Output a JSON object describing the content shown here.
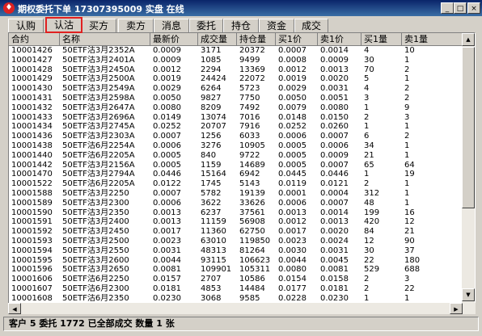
{
  "window": {
    "title": "期权委托下单 17307395009 实盘 在线",
    "minimize": "_",
    "maximize": "□",
    "close": "×"
  },
  "tabs": [
    "认购",
    "认沽",
    "买方",
    "卖方",
    "消息",
    "委托",
    "持仓",
    "资金",
    "成交"
  ],
  "active_tab": "认沽",
  "columns": [
    "合约",
    "名称",
    "最新价",
    "成交量",
    "持仓量",
    "买1价",
    "卖1价",
    "买1量",
    "卖1量"
  ],
  "rows": [
    [
      "10001426",
      "50ETF沽3月2352A",
      "0.0009",
      "3171",
      "20372",
      "0.0007",
      "0.0014",
      "4",
      "10"
    ],
    [
      "10001427",
      "50ETF沽3月2401A",
      "0.0009",
      "1085",
      "9499",
      "0.0008",
      "0.0009",
      "30",
      "1"
    ],
    [
      "10001428",
      "50ETF沽3月2450A",
      "0.0012",
      "2294",
      "13369",
      "0.0012",
      "0.0013",
      "70",
      "2"
    ],
    [
      "10001429",
      "50ETF沽3月2500A",
      "0.0019",
      "24424",
      "22072",
      "0.0019",
      "0.0020",
      "5",
      "1"
    ],
    [
      "10001430",
      "50ETF沽3月2549A",
      "0.0029",
      "6264",
      "5723",
      "0.0029",
      "0.0031",
      "4",
      "2"
    ],
    [
      "10001431",
      "50ETF沽3月2598A",
      "0.0050",
      "9827",
      "7750",
      "0.0050",
      "0.0051",
      "3",
      "2"
    ],
    [
      "10001432",
      "50ETF沽3月2647A",
      "0.0080",
      "8209",
      "7492",
      "0.0079",
      "0.0080",
      "1",
      "9"
    ],
    [
      "10001433",
      "50ETF沽3月2696A",
      "0.0149",
      "13074",
      "7016",
      "0.0148",
      "0.0150",
      "2",
      "3"
    ],
    [
      "10001434",
      "50ETF沽3月2745A",
      "0.0252",
      "20707",
      "7916",
      "0.0252",
      "0.0260",
      "1",
      "1"
    ],
    [
      "10001436",
      "50ETF沽3月2303A",
      "0.0007",
      "1256",
      "6033",
      "0.0006",
      "0.0007",
      "6",
      "2"
    ],
    [
      "10001438",
      "50ETF沽6月2254A",
      "0.0006",
      "3276",
      "10905",
      "0.0005",
      "0.0006",
      "34",
      "1"
    ],
    [
      "10001440",
      "50ETF沽6月2205A",
      "0.0005",
      "840",
      "9722",
      "0.0005",
      "0.0009",
      "21",
      "1"
    ],
    [
      "10001442",
      "50ETF沽3月2156A",
      "0.0005",
      "1159",
      "14689",
      "0.0005",
      "0.0007",
      "65",
      "64"
    ],
    [
      "10001470",
      "50ETF沽3月2794A",
      "0.0446",
      "15164",
      "6942",
      "0.0445",
      "0.0446",
      "1",
      "19"
    ],
    [
      "10001522",
      "50ETF沽6月2205A",
      "0.0122",
      "1745",
      "5143",
      "0.0119",
      "0.0121",
      "2",
      "1"
    ],
    [
      "10001588",
      "50ETF沽3月2250",
      "0.0007",
      "5782",
      "19139",
      "0.0001",
      "0.0004",
      "312",
      "1"
    ],
    [
      "10001589",
      "50ETF沽3月2300",
      "0.0006",
      "3622",
      "33626",
      "0.0006",
      "0.0007",
      "48",
      "1"
    ],
    [
      "10001590",
      "50ETF沽3月2350",
      "0.0013",
      "6237",
      "37561",
      "0.0013",
      "0.0014",
      "199",
      "16"
    ],
    [
      "10001591",
      "50ETF沽3月2400",
      "0.0013",
      "11159",
      "56908",
      "0.0012",
      "0.0013",
      "420",
      "12"
    ],
    [
      "10001592",
      "50ETF沽3月2450",
      "0.0017",
      "11360",
      "62750",
      "0.0017",
      "0.0020",
      "84",
      "21"
    ],
    [
      "10001593",
      "50ETF沽3月2500",
      "0.0023",
      "63010",
      "119850",
      "0.0023",
      "0.0024",
      "12",
      "90"
    ],
    [
      "10001594",
      "50ETF沽3月2550",
      "0.0031",
      "48313",
      "81264",
      "0.0030",
      "0.0031",
      "30",
      "37"
    ],
    [
      "10001595",
      "50ETF沽3月2600",
      "0.0044",
      "93115",
      "106623",
      "0.0044",
      "0.0045",
      "22",
      "180"
    ],
    [
      "10001596",
      "50ETF沽3月2650",
      "0.0081",
      "109901",
      "105311",
      "0.0080",
      "0.0081",
      "529",
      "688"
    ],
    [
      "10001606",
      "50ETF沽6月2250",
      "0.0157",
      "2707",
      "10586",
      "0.0154",
      "0.0158",
      "2",
      "3"
    ],
    [
      "10001607",
      "50ETF沽6月2300",
      "0.0181",
      "4853",
      "14484",
      "0.0177",
      "0.0181",
      "2",
      "22"
    ],
    [
      "10001608",
      "50ETF沽6月2350",
      "0.0230",
      "3068",
      "9585",
      "0.0228",
      "0.0230",
      "1",
      "1"
    ],
    [
      "10001609",
      "50ETF沽6月2400",
      "0.0282",
      "3172",
      "12360",
      "0.0282",
      "0.0287",
      "1",
      "1"
    ]
  ],
  "status": "客户 5 委托 1772 已全部成交 数量 1 张",
  "colors": {
    "active_tab_border": "#e02020",
    "title_bar": "#0a246a",
    "app_icon": "#dd2222"
  },
  "icons": {
    "app": "app-logo-icon",
    "scroll_up": "arrow-up-icon",
    "scroll_down": "arrow-down-icon",
    "scroll_left": "arrow-left-icon",
    "scroll_right": "arrow-right-icon"
  }
}
